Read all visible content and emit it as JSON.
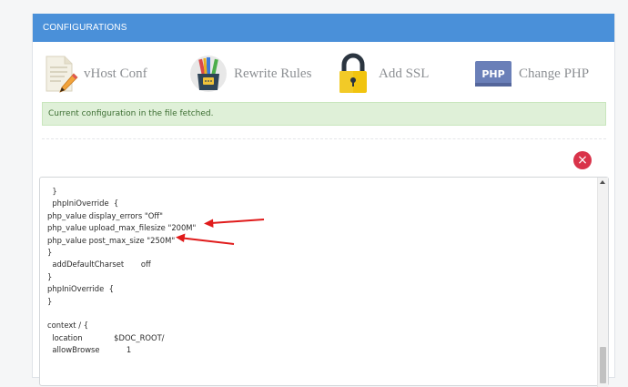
{
  "panel": {
    "title": "CONFIGURATIONS"
  },
  "tools": [
    {
      "label": "vHost Conf",
      "icon": "document-pencil-icon"
    },
    {
      "label": "Rewrite Rules",
      "icon": "pencil-cup-icon"
    },
    {
      "label": "Add SSL",
      "icon": "padlock-icon"
    },
    {
      "label": "Change PHP",
      "icon": "php-badge-icon"
    }
  ],
  "alert": {
    "message": "Current configuration in the file fetched."
  },
  "close_button": {
    "icon": "close-icon",
    "glyph": "×"
  },
  "editor": {
    "lines": [
      "  }",
      "  phpIniOverride  {",
      "php_value display_errors \"Off\"",
      "php_value upload_max_filesize \"200M\"",
      "php_value post_max_size \"250M\"",
      "}",
      "  addDefaultCharset       off",
      "}",
      "phpIniOverride  {",
      "}",
      "",
      "context / {",
      "  location             $DOC_ROOT/",
      "  allowBrowse           1"
    ]
  },
  "colors": {
    "header": "#4a90d9",
    "alert_bg": "#dff0d8",
    "alert_text": "#3c6e32",
    "close": "#d9334a",
    "annotation_arrow": "#e01b1b"
  }
}
